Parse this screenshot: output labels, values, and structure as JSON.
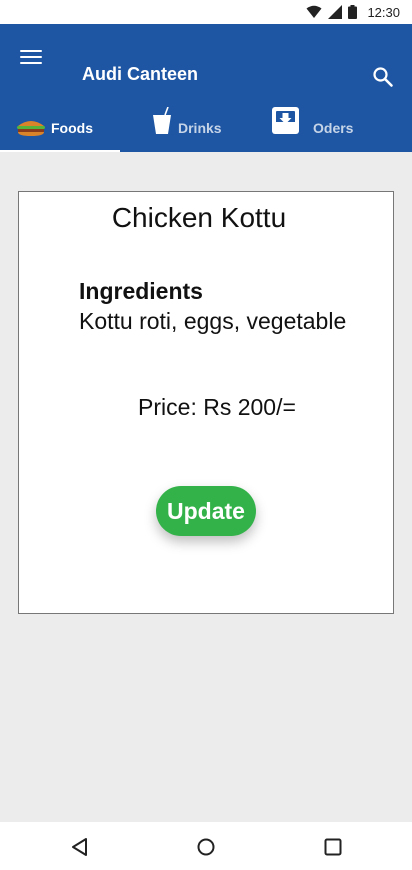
{
  "status_bar": {
    "time": "12:30"
  },
  "app": {
    "title": "Audi Canteen"
  },
  "tabs": [
    {
      "label": "Foods",
      "icon": "burger-icon",
      "active": true
    },
    {
      "label": "Drinks",
      "icon": "cup-icon",
      "active": false
    },
    {
      "label": "Oders",
      "icon": "inbox-download-icon",
      "active": false
    }
  ],
  "food": {
    "name": "Chicken Kottu",
    "ingredients_heading": "Ingredients",
    "ingredients": "Kottu roti, eggs, vegetable",
    "price": "Price: Rs 200/="
  },
  "actions": {
    "update_label": "Update"
  },
  "colors": {
    "app_bar": "#1e56a3",
    "update_button": "#34b24a",
    "background": "#ececec"
  }
}
